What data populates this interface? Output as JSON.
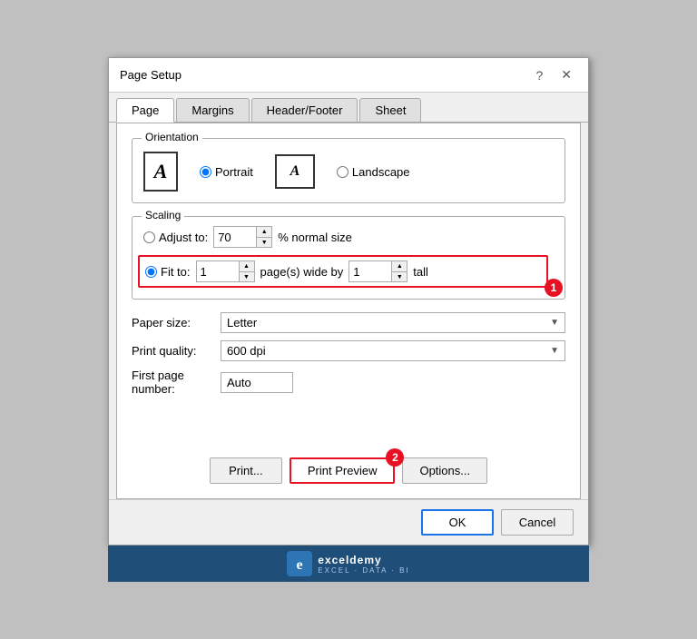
{
  "dialog": {
    "title": "Page Setup",
    "help_label": "?",
    "close_label": "✕"
  },
  "tabs": [
    {
      "id": "page",
      "label": "Page",
      "active": true
    },
    {
      "id": "margins",
      "label": "Margins",
      "active": false
    },
    {
      "id": "header_footer",
      "label": "Header/Footer",
      "active": false
    },
    {
      "id": "sheet",
      "label": "Sheet",
      "active": false
    }
  ],
  "orientation": {
    "title": "Orientation",
    "portrait_label": "Portrait",
    "landscape_label": "Landscape",
    "portrait_icon": "A",
    "landscape_icon": "A"
  },
  "scaling": {
    "title": "Scaling",
    "adjust_label": "Adjust to:",
    "adjust_value": "70",
    "adjust_suffix": "% normal size",
    "fit_label": "Fit to:",
    "fit_wide_value": "1",
    "fit_wide_suffix": "page(s) wide by",
    "fit_tall_value": "1",
    "fit_tall_suffix": "tall"
  },
  "paper": {
    "label": "Paper size:",
    "value": "Letter"
  },
  "print_quality": {
    "label": "Print quality:",
    "value": "600 dpi"
  },
  "first_page": {
    "label": "First page number:",
    "value": "Auto"
  },
  "buttons": {
    "print_label": "Print...",
    "preview_label": "Print Preview",
    "options_label": "Options...",
    "ok_label": "OK",
    "cancel_label": "Cancel"
  },
  "badges": {
    "badge1": "1",
    "badge2": "2"
  },
  "exceldemy": {
    "brand": "exceldemy",
    "tagline": "EXCEL · DATA · BI"
  }
}
